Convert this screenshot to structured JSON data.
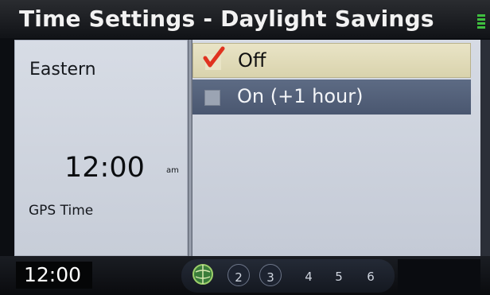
{
  "header": {
    "title": "Time Settings - Daylight Savings"
  },
  "left_panel": {
    "zone": "Eastern",
    "time": "12:00",
    "ampm": "am",
    "source": "GPS Time"
  },
  "options": [
    {
      "label": "Off",
      "checked": true
    },
    {
      "label": "On (+1 hour)",
      "checked": false
    }
  ],
  "bottom_bar": {
    "clock": "12:00",
    "presets": [
      "2",
      "3",
      "4",
      "5",
      "6"
    ]
  },
  "colors": {
    "selected_row": "#e9e4c6",
    "highlight_row": "#4f5c75",
    "check_red": "#e0331f",
    "signal_green": "#3fbf3f"
  }
}
